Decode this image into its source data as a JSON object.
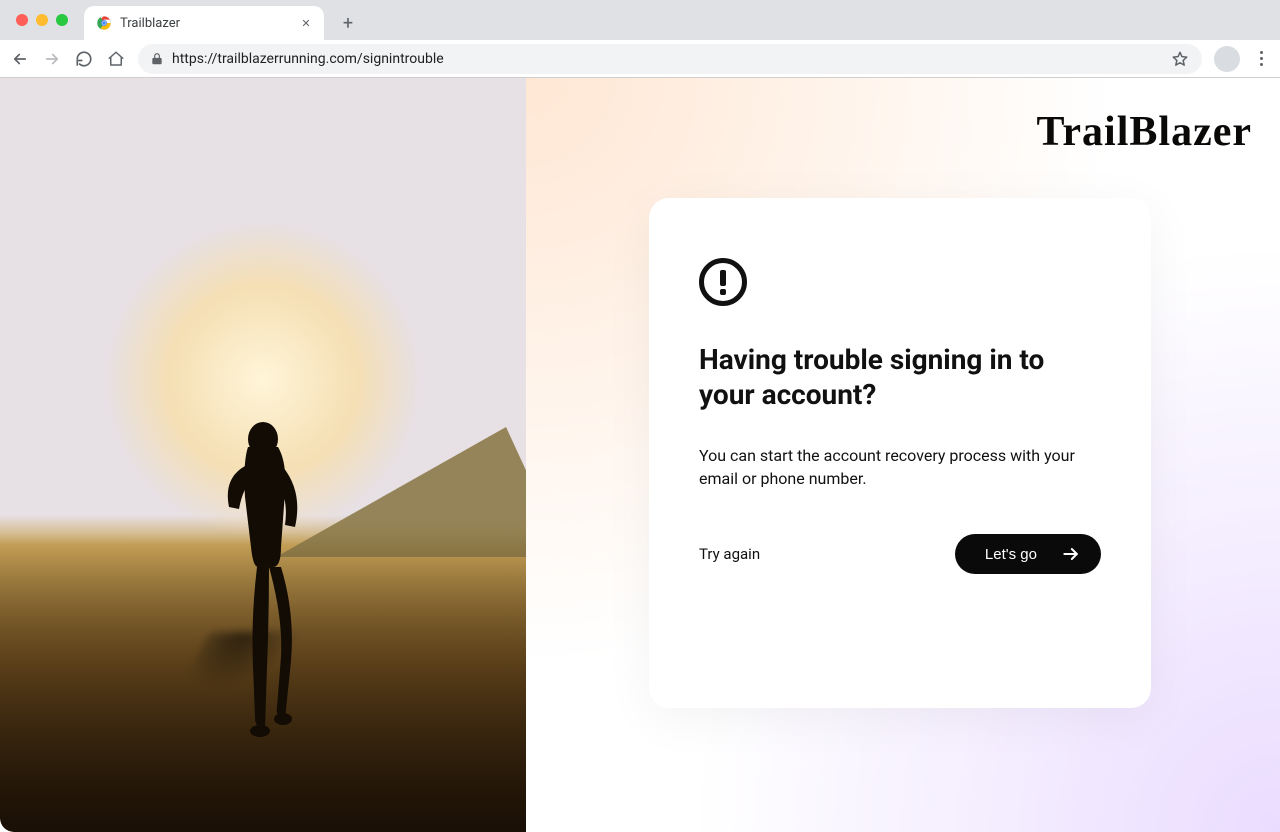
{
  "browser": {
    "tab_title": "Trailblazer",
    "url": "https://trailblazerrunning.com/signintrouble"
  },
  "brand": {
    "logo_text": "TrailBlazer"
  },
  "card": {
    "heading": "Having trouble signing in to your account?",
    "description": "You can start the account recovery process with your email or phone number.",
    "secondary_label": "Try again",
    "primary_label": "Let's go"
  }
}
